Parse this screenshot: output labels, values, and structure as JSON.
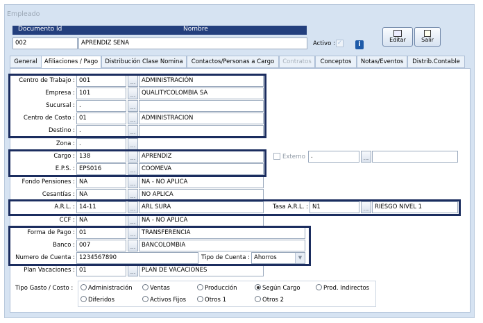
{
  "window": {
    "title": "Empleado"
  },
  "header": {
    "doc_label": "Documento Id",
    "name_label": "Nombre",
    "doc_value": "002",
    "name_value": "APRENDIZ SENA",
    "active_label": "Activo :",
    "info_icon": "i",
    "edit_label": "Editar",
    "exit_label": "Salir"
  },
  "tabs": [
    {
      "label": "General"
    },
    {
      "label": "Afiliaciones / Pago"
    },
    {
      "label": "Distribución Clase Nomina"
    },
    {
      "label": "Contactos/Personas a Cargo"
    },
    {
      "label": "Contratos"
    },
    {
      "label": "Conceptos"
    },
    {
      "label": "Notas/Eventos"
    },
    {
      "label": "Distrib.Contable"
    }
  ],
  "form": {
    "centro_trabajo": {
      "label": "Centro de Trabajo :",
      "code": "001",
      "desc": "ADMINISTRACIÓN"
    },
    "empresa": {
      "label": "Empresa :",
      "code": "101",
      "desc": "QUALITYCOLOMBIA SA"
    },
    "sucursal": {
      "label": "Sucursal :",
      "code": ".",
      "desc": ""
    },
    "centro_costo": {
      "label": "Centro de Costo :",
      "code": "01",
      "desc": "ADMINISTRACION"
    },
    "destino": {
      "label": "Destino :",
      "code": ".",
      "desc": ""
    },
    "zona": {
      "label": "Zona :",
      "code": "."
    },
    "cargo": {
      "label": "Cargo :",
      "code": "138",
      "desc": "APRENDIZ"
    },
    "eps": {
      "label": "E.P.S. :",
      "code": "EPS016",
      "desc": "COOMEVA"
    },
    "externo": {
      "label": "Externo",
      "code": ".",
      "desc": ""
    },
    "fondo_pensiones": {
      "label": "Fondo Pensiones :",
      "code": "NA",
      "desc": "NA - NO APLICA"
    },
    "cesantias": {
      "label": "Cesantías :",
      "code": "NA",
      "desc": "NO APLICA"
    },
    "arl": {
      "label": "A.R.L. :",
      "code": "14-11",
      "desc": "ARL SURA"
    },
    "tasa_arl": {
      "label": "Tasa A.R.L. :",
      "code": "N1",
      "desc": "RIESGO NIVEL 1"
    },
    "ccf": {
      "label": "CCF :",
      "code": "NA",
      "desc": "NA - NO APLICA"
    },
    "forma_pago": {
      "label": "Forma de Pago :",
      "code": "01",
      "desc": "TRANSFERENCIA"
    },
    "banco": {
      "label": "Banco :",
      "code": "007",
      "desc": "BANCOLOMBIA"
    },
    "numero_cuenta": {
      "label": "Numero de Cuenta :",
      "value": "1234567890"
    },
    "tipo_cuenta": {
      "label": "Tipo de Cuenta :",
      "value": "Ahorros"
    },
    "plan_vacaciones": {
      "label": "Plan Vacaciones :",
      "code": "01",
      "desc": "PLAN DE VACACIONES"
    },
    "tipo_gasto": {
      "label": "Tipo Gasto / Costo :",
      "options": [
        "Administración",
        "Ventas",
        "Producción",
        "Según Cargo",
        "Prod. Indirectos",
        "Diferidos",
        "Activos Fijos",
        "Otros 1",
        "Otros 2"
      ]
    },
    "ellipsis": "..."
  }
}
